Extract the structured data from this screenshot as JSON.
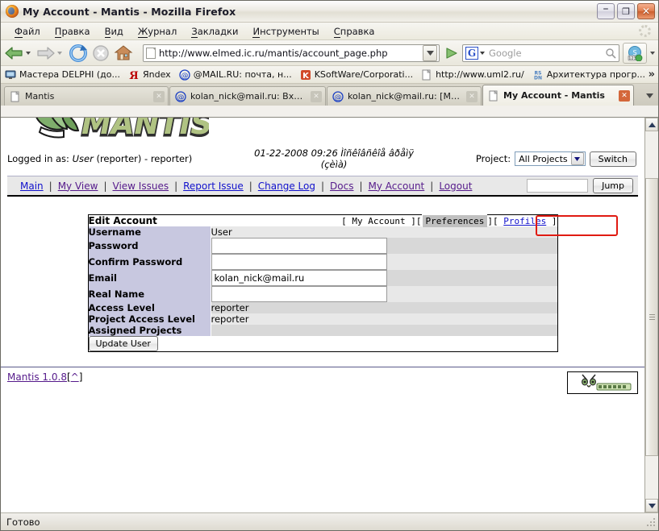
{
  "window": {
    "title": "My Account - Mantis - Mozilla Firefox",
    "icon": "firefox-icon",
    "minimize_label": "–",
    "maximize_label": "❐",
    "close_label": "✕"
  },
  "menubar": {
    "items": [
      {
        "label": "Файл",
        "accel": "Ф"
      },
      {
        "label": "Правка",
        "accel": "П"
      },
      {
        "label": "Вид",
        "accel": "В"
      },
      {
        "label": "Журнал",
        "accel": "Ж"
      },
      {
        "label": "Закладки",
        "accel": "З"
      },
      {
        "label": "Инструменты",
        "accel": "И"
      },
      {
        "label": "Справка",
        "accel": "С"
      }
    ]
  },
  "toolbar": {
    "back_icon": "back-arrow-icon",
    "forward_icon": "forward-arrow-icon",
    "reload_icon": "reload-icon",
    "stop_icon": "stop-icon",
    "home_icon": "home-icon",
    "url_value": "http://www.elmed.ic.ru/mantis/account_page.php",
    "url_dropdown_icon": "chevron-down-icon",
    "go_icon": "go-icon",
    "search_engine": "G",
    "search_placeholder": "Google",
    "search_icon": "magnifier-icon",
    "skype_icon": "skype-icon"
  },
  "bookmarks": {
    "items": [
      {
        "label": "Мастера DELPHI (до...",
        "icon": "monitor-icon"
      },
      {
        "label": "Яndex",
        "icon": "yandex-icon"
      },
      {
        "label": "@MAIL.RU: почта, н...",
        "icon": "mailru-icon"
      },
      {
        "label": "KSoftWare/Corporati...",
        "icon": "ksoftware-icon"
      },
      {
        "label": "http://www.uml2.ru/",
        "icon": "page-icon"
      },
      {
        "label": "Архитектура прогр...",
        "icon": "rsdn-icon"
      }
    ],
    "overflow_label": "»"
  },
  "tabs": {
    "items": [
      {
        "label": "Mantis",
        "icon": "page-icon",
        "active": false,
        "close_label": "✕"
      },
      {
        "label": "kolan_nick@mail.ru: Входя...",
        "icon": "at-icon",
        "active": false,
        "close_label": "✕"
      },
      {
        "label": "kolan_nick@mail.ru: [Manti...",
        "icon": "at-icon",
        "active": false,
        "close_label": "✕"
      },
      {
        "label": "My Account - Mantis",
        "icon": "page-icon",
        "active": true,
        "close_label": "✕"
      }
    ],
    "list_all_icon": "chevron-down-icon"
  },
  "page": {
    "logo_alt": "MANTIS",
    "logo_text": "MANTIS",
    "logged_in_prefix": "Logged in as: ",
    "logged_in_user": "User",
    "logged_in_suffix": " (reporter) - reporter)",
    "datetime_line1": "01-22-2008 09:26 Ìîñêîâñêîå âðåìÿ",
    "datetime_line2": "(çèìà)",
    "project_label": "Project:",
    "project_value": "All Projects",
    "project_dropdown_icon": "chevron-down-icon",
    "switch_button": "Switch",
    "nav_links": [
      {
        "label": "Main",
        "visited": false
      },
      {
        "label": "My View",
        "visited": true
      },
      {
        "label": "View Issues",
        "visited": true
      },
      {
        "label": "Report Issue",
        "visited": false
      },
      {
        "label": "Change Log",
        "visited": false
      },
      {
        "label": "Docs",
        "visited": true
      },
      {
        "label": "My Account",
        "visited": true
      },
      {
        "label": "Logout",
        "visited": true
      }
    ],
    "nav_separator": "|",
    "jump_input_value": "",
    "jump_button": "Jump",
    "footer_version": "Mantis 1.0.8",
    "footer_bracket_open": "[",
    "footer_top_icon": "up-chevron-icon",
    "footer_bracket_close": "]",
    "footer_logo_alt": "Powered by Mantis Bugtracker"
  },
  "account": {
    "title": "Edit Account",
    "header_tabs": [
      {
        "label": "My Account",
        "selected": false,
        "link": false
      },
      {
        "label": "Preferences",
        "selected": true,
        "link": false
      },
      {
        "label": "Profiles",
        "selected": false,
        "link": true
      }
    ],
    "bracket_open": "[",
    "bracket_close": "]",
    "rows": [
      {
        "label": "Username",
        "type": "text",
        "value": "User"
      },
      {
        "label": "Password",
        "type": "input",
        "value": ""
      },
      {
        "label": "Confirm Password",
        "type": "input",
        "value": ""
      },
      {
        "label": "Email",
        "type": "input",
        "value": "kolan_nick@mail.ru"
      },
      {
        "label": "Real Name",
        "type": "input",
        "value": ""
      },
      {
        "label": "Access Level",
        "type": "text",
        "value": "reporter"
      },
      {
        "label": "Project Access Level",
        "type": "text",
        "value": "reporter"
      },
      {
        "label": "Assigned Projects",
        "type": "text",
        "value": ""
      }
    ],
    "submit_button": "Update User",
    "highlight_color": "#e01b12"
  },
  "scrollbar": {
    "up_icon": "chevron-up-icon",
    "down_icon": "chevron-down-icon"
  },
  "statusbar": {
    "text": "Готово"
  }
}
